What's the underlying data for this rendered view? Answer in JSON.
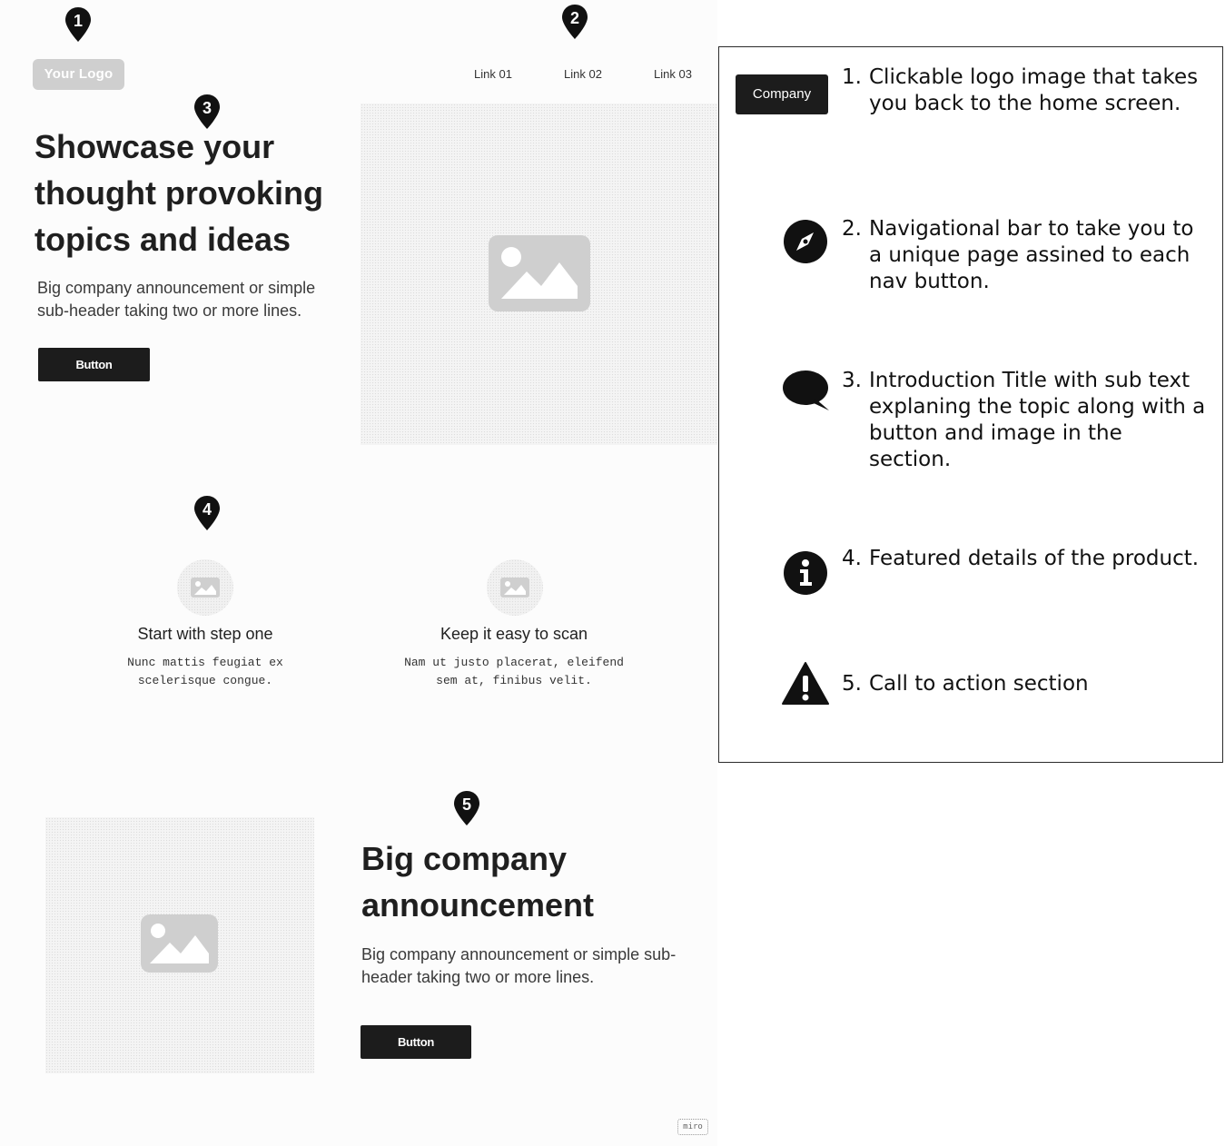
{
  "header": {
    "logo_text": "Your Logo",
    "nav_links": [
      "Link 01",
      "Link 02",
      "Link 03"
    ]
  },
  "hero": {
    "title": "Showcase your thought provoking topics and ideas",
    "subtitle": "Big company announcement or simple sub-header taking two or more lines.",
    "button_label": "Button"
  },
  "features": [
    {
      "title": "Start with step one",
      "text": "Nunc mattis feugiat ex scelerisque congue."
    },
    {
      "title": "Keep it easy to scan",
      "text": "Nam ut justo placerat, eleifend sem at, finibus velit."
    }
  ],
  "cta": {
    "title": "Big company announcement",
    "subtitle": "Big company announcement or simple sub-header taking two or more lines.",
    "button_label": "Button"
  },
  "markers": [
    "1",
    "2",
    "3",
    "4",
    "5"
  ],
  "legend": {
    "company_label": "Company",
    "items": [
      {
        "num": "1.",
        "text": "Clickable logo image that takes you back to the home screen.",
        "icon": "company-badge"
      },
      {
        "num": "2.",
        "text": "Navigational bar to take you to a unique page assined to each nav button.",
        "icon": "compass-icon"
      },
      {
        "num": "3.",
        "text": "Introduction Title with sub text explaning the topic along with a button and image in the section.",
        "icon": "speech-bubble-icon"
      },
      {
        "num": "4.",
        "text": "Featured details of the product.",
        "icon": "info-icon"
      },
      {
        "num": "5.",
        "text": "Call to action section",
        "icon": "warning-icon"
      }
    ]
  },
  "watermark": "miro",
  "colors": {
    "dark": "#1c1c1c",
    "placeholder": "#cfcfcf",
    "text": "#1f1f1f"
  }
}
